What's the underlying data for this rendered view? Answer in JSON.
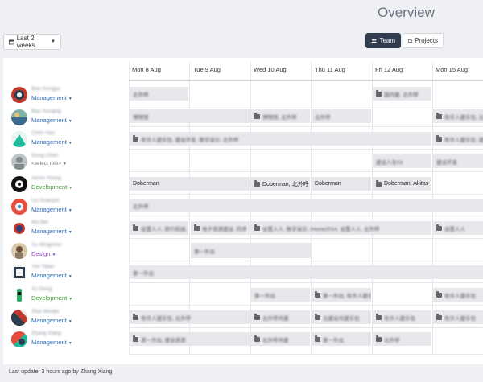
{
  "header": {
    "title": "Overview"
  },
  "toolbar": {
    "range_label": "Last 2 weeks",
    "team_label": "Team",
    "projects_label": "Projects"
  },
  "days": [
    "Mon 8 Aug",
    "Tue 9 Aug",
    "Wed 10 Aug",
    "Thu 11 Aug",
    "Fri 12 Aug",
    "Mon 15 Aug"
  ],
  "members": [
    {
      "name": "Bao Hongyu",
      "role": "Management"
    },
    {
      "name": "Bao Yunqing",
      "role": "Management"
    },
    {
      "name": "Chen Hao",
      "role": "Management"
    },
    {
      "name": "Gong Chen",
      "role": "<select role>"
    },
    {
      "name": "Jervis Young",
      "role": "Development"
    },
    {
      "name": "Liu Guanjun",
      "role": "Management"
    },
    {
      "name": "Wu Bei",
      "role": "Management"
    },
    {
      "name": "Xu Mingchen",
      "role": "Design"
    },
    {
      "name": "Yan Yijiao",
      "role": "Management"
    },
    {
      "name": "Yu Dong",
      "role": "Development"
    },
    {
      "name": "Zhai Wenjie",
      "role": "Management"
    },
    {
      "name": "Zhang Xiang",
      "role": "Management"
    }
  ],
  "cells": {
    "r1_mon": "北外呼",
    "r1_fri": "国内建, 北外呼",
    "r2_montue": "博物馆",
    "r2_wed": "博物馆, 北外呼",
    "r2_thu": "北外呼",
    "r2_mon15": "有许人建乐包, 北外呼",
    "r3_span": "有许人建乐包, 建设开发, 数学演示, 北外呼",
    "r3_mon15": "有许人建乐包, 建设开发",
    "r4_fri": "建设人生03",
    "r4_mon15": "建设开发",
    "r5_mon": "Doberman",
    "r5_wed": "Doberman, 北外呼",
    "r5_thu": "Doberman",
    "r5_fri": "Doberman, Akitas",
    "r6_span": "北外呼",
    "r7_mon": "设置人人, 即行机接, 设置",
    "r7_tue": "电子资源建设, 同步",
    "r7_wedfri": "设置人人, 数学演示, IHome2014, 设置人人, 北外呼",
    "r7_mon15": "设置人人",
    "r8_tue": "第一外出",
    "r9_span": "第一外出",
    "r10_wed": "第一外出",
    "r10_thu": "第一外出, 有许人建乐包",
    "r10_mon15": "有许人建乐包",
    "r11_montue": "有许人建乐包, 北外呼",
    "r11_wed": "北外呼共建",
    "r11_thu": "北建设共建乐包",
    "r11_fri": "有许人建乐包",
    "r11_mon15": "有许人建乐包",
    "r12_montue": "第一外出, 建设资源",
    "r12_wed": "北外呼共建",
    "r12_thu": "第一外出",
    "r12_fri": "北外呼"
  },
  "footer": {
    "last_update": "Last update: 3 hours ago by Zhang Xiang"
  }
}
